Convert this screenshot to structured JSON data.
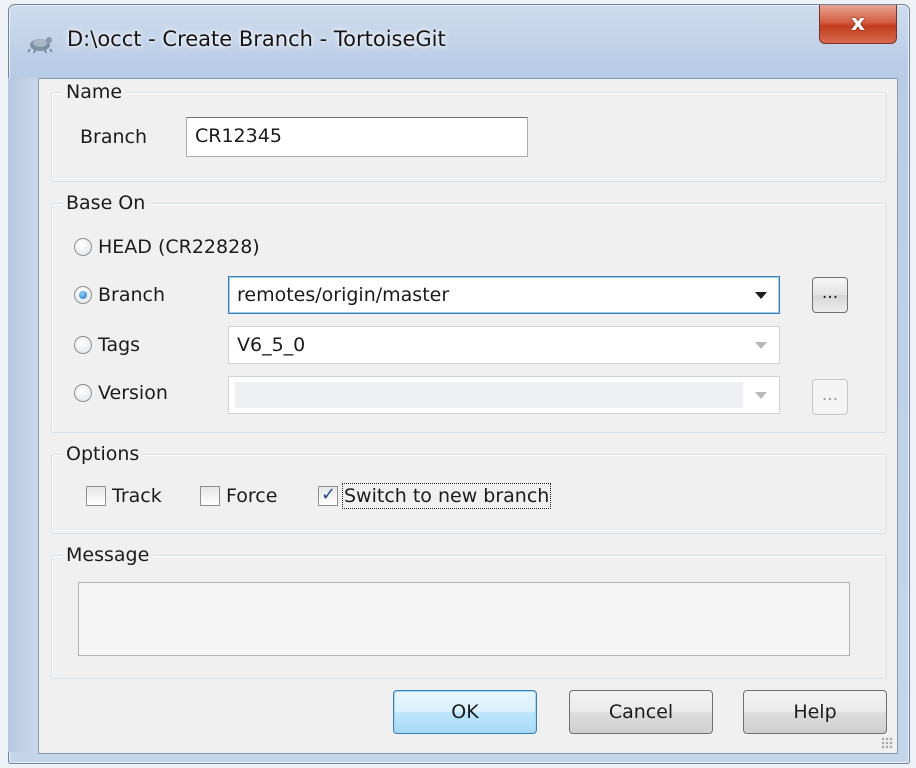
{
  "window": {
    "title": "D:\\occt - Create Branch - TortoiseGit",
    "close_glyph": "x"
  },
  "name_group": {
    "label": "Name",
    "branch_label": "Branch",
    "branch_value": "CR12345"
  },
  "base_on_group": {
    "label": "Base On",
    "head_option": "HEAD (CR22828)",
    "branch_option": "Branch",
    "branch_value": "remotes/origin/master",
    "tags_option": "Tags",
    "tags_value": "V6_5_0",
    "version_option": "Version",
    "version_value": "",
    "selected": "Branch",
    "browse_label": "..."
  },
  "options_group": {
    "label": "Options",
    "track_label": "Track",
    "track_checked": false,
    "force_label": "Force",
    "force_checked": false,
    "switch_label": "Switch to new branch",
    "switch_checked": true
  },
  "message_group": {
    "label": "Message",
    "value": ""
  },
  "buttons": {
    "ok": "OK",
    "cancel": "Cancel",
    "help": "Help"
  },
  "colors": {
    "accent": "#3c7fb1",
    "close": "#c23d1f",
    "client_bg": "#f0f0f0"
  }
}
